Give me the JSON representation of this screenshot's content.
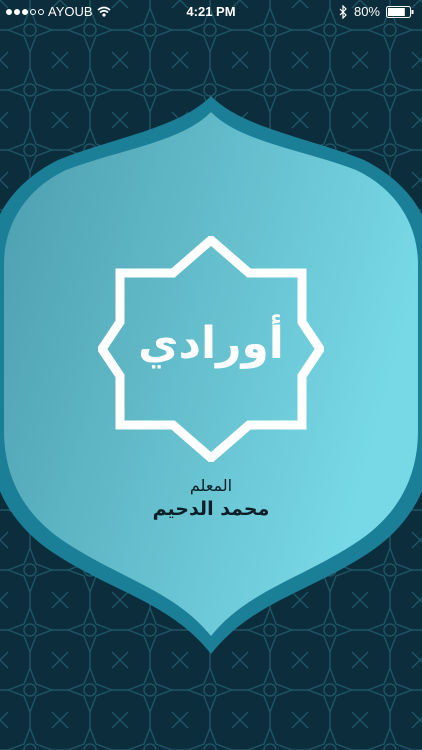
{
  "status_bar": {
    "carrier": "AYOUB",
    "time": "4:21 PM",
    "battery_percent": "80%",
    "battery_level": 0.8,
    "signal_bars": 3,
    "icons": [
      "signal-dots-icon",
      "wifi-icon",
      "bluetooth-icon",
      "battery-icon"
    ]
  },
  "splash": {
    "app_name": "أورادي",
    "teacher_label": "المعلم",
    "teacher_name": "محمد الدحيم"
  },
  "colors": {
    "background": "#0c2d3b",
    "pattern": "#1f5566",
    "frame_border": "#1b7f97",
    "gradient_start": "#4d9eae",
    "gradient_end": "#78d9e6",
    "logo": "#ffffff",
    "text": "#0c1f28"
  }
}
